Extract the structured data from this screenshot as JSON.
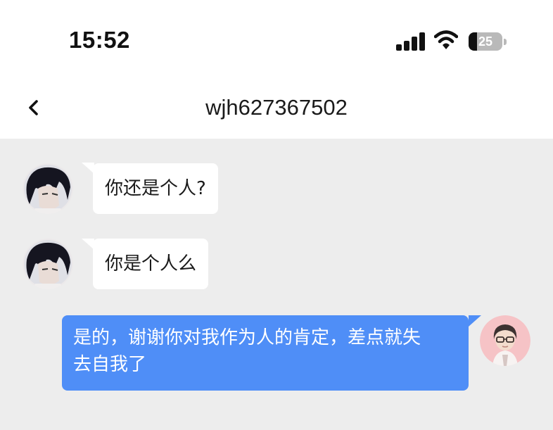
{
  "status_bar": {
    "time": "15:52",
    "battery_level": "25"
  },
  "header": {
    "title": "wjh627367502"
  },
  "messages": [
    {
      "sender": "contact",
      "text": "你还是个人?"
    },
    {
      "sender": "contact",
      "text": "你是个人么"
    },
    {
      "sender": "me",
      "line1": "是的，谢谢你对我作为人的肯定，差点就失",
      "line2": "去自我了"
    }
  ],
  "colors": {
    "outgoing_bubble": "#4f8ef7",
    "incoming_bubble": "#ffffff",
    "chat_background": "#ededed"
  }
}
